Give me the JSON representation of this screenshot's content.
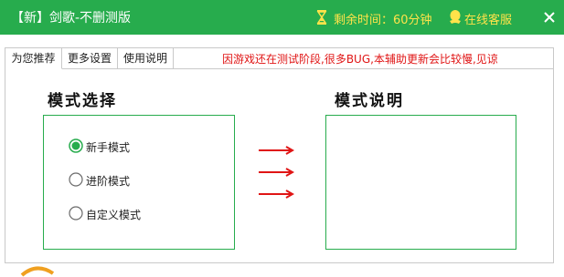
{
  "window": {
    "title": "【新】剑歌-不删测版",
    "timer": "剩余时间：60分钟",
    "service": "在线客服"
  },
  "tabs": [
    {
      "label": "为您推荐",
      "active": true
    },
    {
      "label": "更多设置",
      "active": false
    },
    {
      "label": "使用说明",
      "active": false
    }
  ],
  "notice": "因游戏还在测试阶段,很多BUG,本辅助更新会比较慢,见谅",
  "mode_select": {
    "title": "模式选择",
    "options": [
      {
        "label": "新手模式",
        "selected": true
      },
      {
        "label": "进阶模式",
        "selected": false
      },
      {
        "label": "自定义模式",
        "selected": false
      }
    ]
  },
  "mode_desc": {
    "title": "模式说明"
  },
  "colors": {
    "accent": "#27ac4d",
    "timer_text": "#ffe34a",
    "notice_text": "#e01515",
    "arrow": "#e01515"
  }
}
